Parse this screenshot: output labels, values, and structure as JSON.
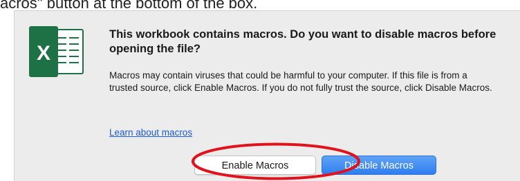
{
  "caption": {
    "text": "acros\" button at the bottom of the box."
  },
  "dialog": {
    "heading": "This workbook contains macros. Do you want to disable macros before opening the file?",
    "body": "Macros may contain viruses that could be harmful to your computer.  If this file is from a trusted source, click Enable Macros. If you do not fully trust the source, click Disable Macros.",
    "learn_link": "Learn about macros",
    "buttons": {
      "enable": "Enable Macros",
      "disable": "Disable Macros"
    },
    "icon": "excel-app-icon",
    "icon_letter": "X"
  },
  "colors": {
    "excel_green": "#1e7145",
    "link_blue": "#1a5bd6",
    "primary_button": "#3b86f2",
    "highlight_red": "#e0121b"
  }
}
